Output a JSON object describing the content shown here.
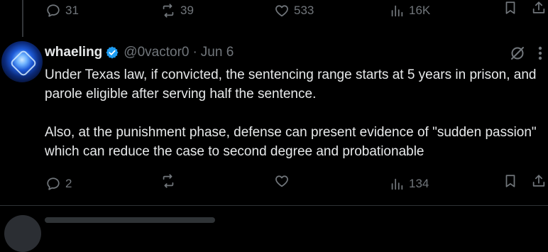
{
  "prev_actions": {
    "replies": "31",
    "reposts": "39",
    "likes": "533",
    "views": "16K"
  },
  "tweet": {
    "display_name": "whaeling",
    "handle": "@0vactor0",
    "separator": "·",
    "date": "Jun 6",
    "paragraphs": [
      "Under Texas law, if convicted, the sentencing range starts at 5 years in prison, and parole eligible after serving half the sentence.",
      "Also, at the punishment phase,  defense can present evidence of \"sudden passion\" which can reduce the case to second degree and probationable"
    ],
    "actions": {
      "replies": "2",
      "reposts": "",
      "likes": "",
      "views": "134"
    }
  },
  "colors": {
    "background": "#000000",
    "text": "#e7e9ea",
    "muted": "#71767b",
    "verified": "#1d9bf0",
    "divider": "#2f3336"
  },
  "icons": [
    "reply-icon",
    "repost-icon",
    "like-icon",
    "views-icon",
    "bookmark-icon",
    "share-icon",
    "verified-badge-icon",
    "grok-icon",
    "more-icon"
  ]
}
